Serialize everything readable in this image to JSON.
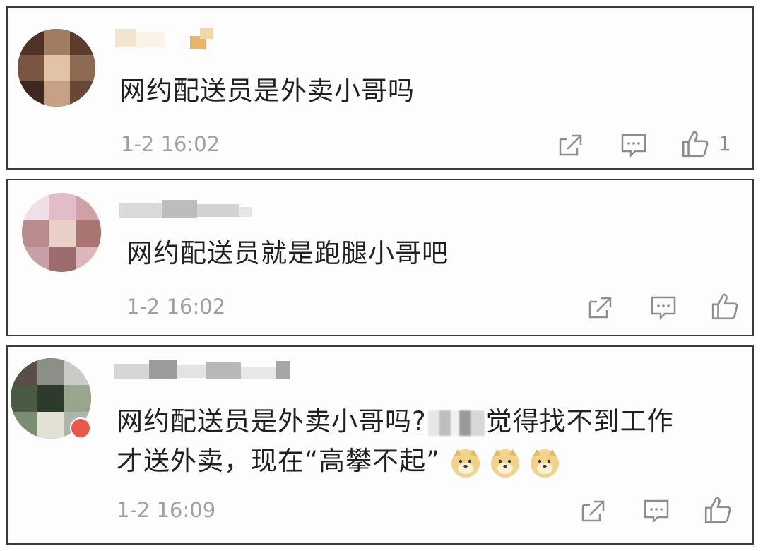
{
  "comments": [
    {
      "text": "网约配送员是外卖小哥吗",
      "timestamp": "1-2 16:02",
      "like_count": "1"
    },
    {
      "text": "网约配送员就是跑腿小哥吧",
      "timestamp": "1-2 16:02",
      "like_count": ""
    },
    {
      "text_line1_a": "网约配送员是外卖小哥吗?",
      "text_line1_b": "觉得找不到工作",
      "text_line2": "才送外卖，现在“高攀不起”",
      "timestamp": "1-2 16:09",
      "like_count": "",
      "emojis": [
        "doge-emoji",
        "doge-emoji",
        "doge-emoji"
      ]
    }
  ],
  "icons": {
    "share": "share-icon",
    "comment": "comment-icon",
    "like": "thumbs-up-icon"
  }
}
